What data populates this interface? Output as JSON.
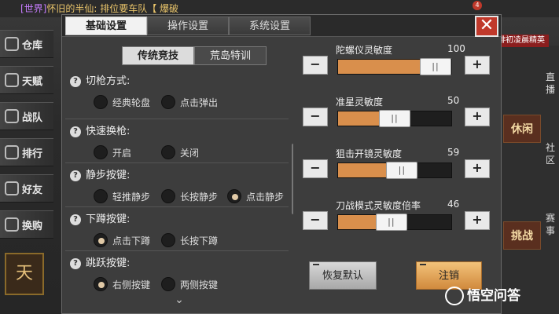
{
  "topbar": {
    "chat_channel": "[世界]",
    "chat_text": "怀旧的半仙: 排位要车队【 爆破",
    "badge": "4"
  },
  "side_menu": [
    {
      "label": "仓库",
      "icon": "warehouse-icon"
    },
    {
      "label": "天赋",
      "icon": "talent-icon"
    },
    {
      "label": "战队",
      "icon": "team-icon"
    },
    {
      "label": "排行",
      "icon": "ranking-icon"
    },
    {
      "label": "好友",
      "icon": "friends-icon"
    },
    {
      "label": "换购",
      "icon": "exchange-icon"
    }
  ],
  "avatar_text": "天",
  "right_panel": {
    "banner": "排初凌晨精英",
    "tabs": [
      "直播",
      "社区",
      "赛事"
    ],
    "cards": [
      "休闲",
      "挑战"
    ]
  },
  "dialog": {
    "tabs": [
      "基础设置",
      "操作设置",
      "系统设置"
    ],
    "active_tab": 0,
    "close_label": "✕",
    "subtabs": [
      "传统竞技",
      "荒岛特训"
    ],
    "active_subtab": 0,
    "sections": [
      {
        "title": "切枪方式:",
        "options": [
          "经典轮盘",
          "点击弹出"
        ],
        "selected": -1
      },
      {
        "title": "快速换枪:",
        "options": [
          "开启",
          "关闭"
        ],
        "selected": -1
      },
      {
        "title": "静步按键:",
        "options": [
          "轻推静步",
          "长按静步",
          "点击静步"
        ],
        "selected": 2
      },
      {
        "title": "下蹲按键:",
        "options": [
          "点击下蹲",
          "长按下蹲"
        ],
        "selected": 0
      },
      {
        "title": "跳跃按键:",
        "options": [
          "右侧按键",
          "两侧按键"
        ],
        "selected": 0
      }
    ],
    "sliders": [
      {
        "label": "陀螺仪灵敏度",
        "value": "100",
        "fraction": 1.0
      },
      {
        "label": "准星灵敏度",
        "value": "50",
        "fraction": 0.5
      },
      {
        "label": "狙击开镜灵敏度",
        "value": "59",
        "fraction": 0.59
      },
      {
        "label": "刀战模式灵敏度倍率",
        "value": "46",
        "fraction": 0.46
      }
    ],
    "minus_label": "−",
    "plus_label": "+",
    "thumb_glyph": "||",
    "reset_label": "恢复默认",
    "logout_label": "注销"
  },
  "watermark": "悟空问答",
  "colors": {
    "accent": "#d98f4c",
    "close": "#c0392b"
  }
}
